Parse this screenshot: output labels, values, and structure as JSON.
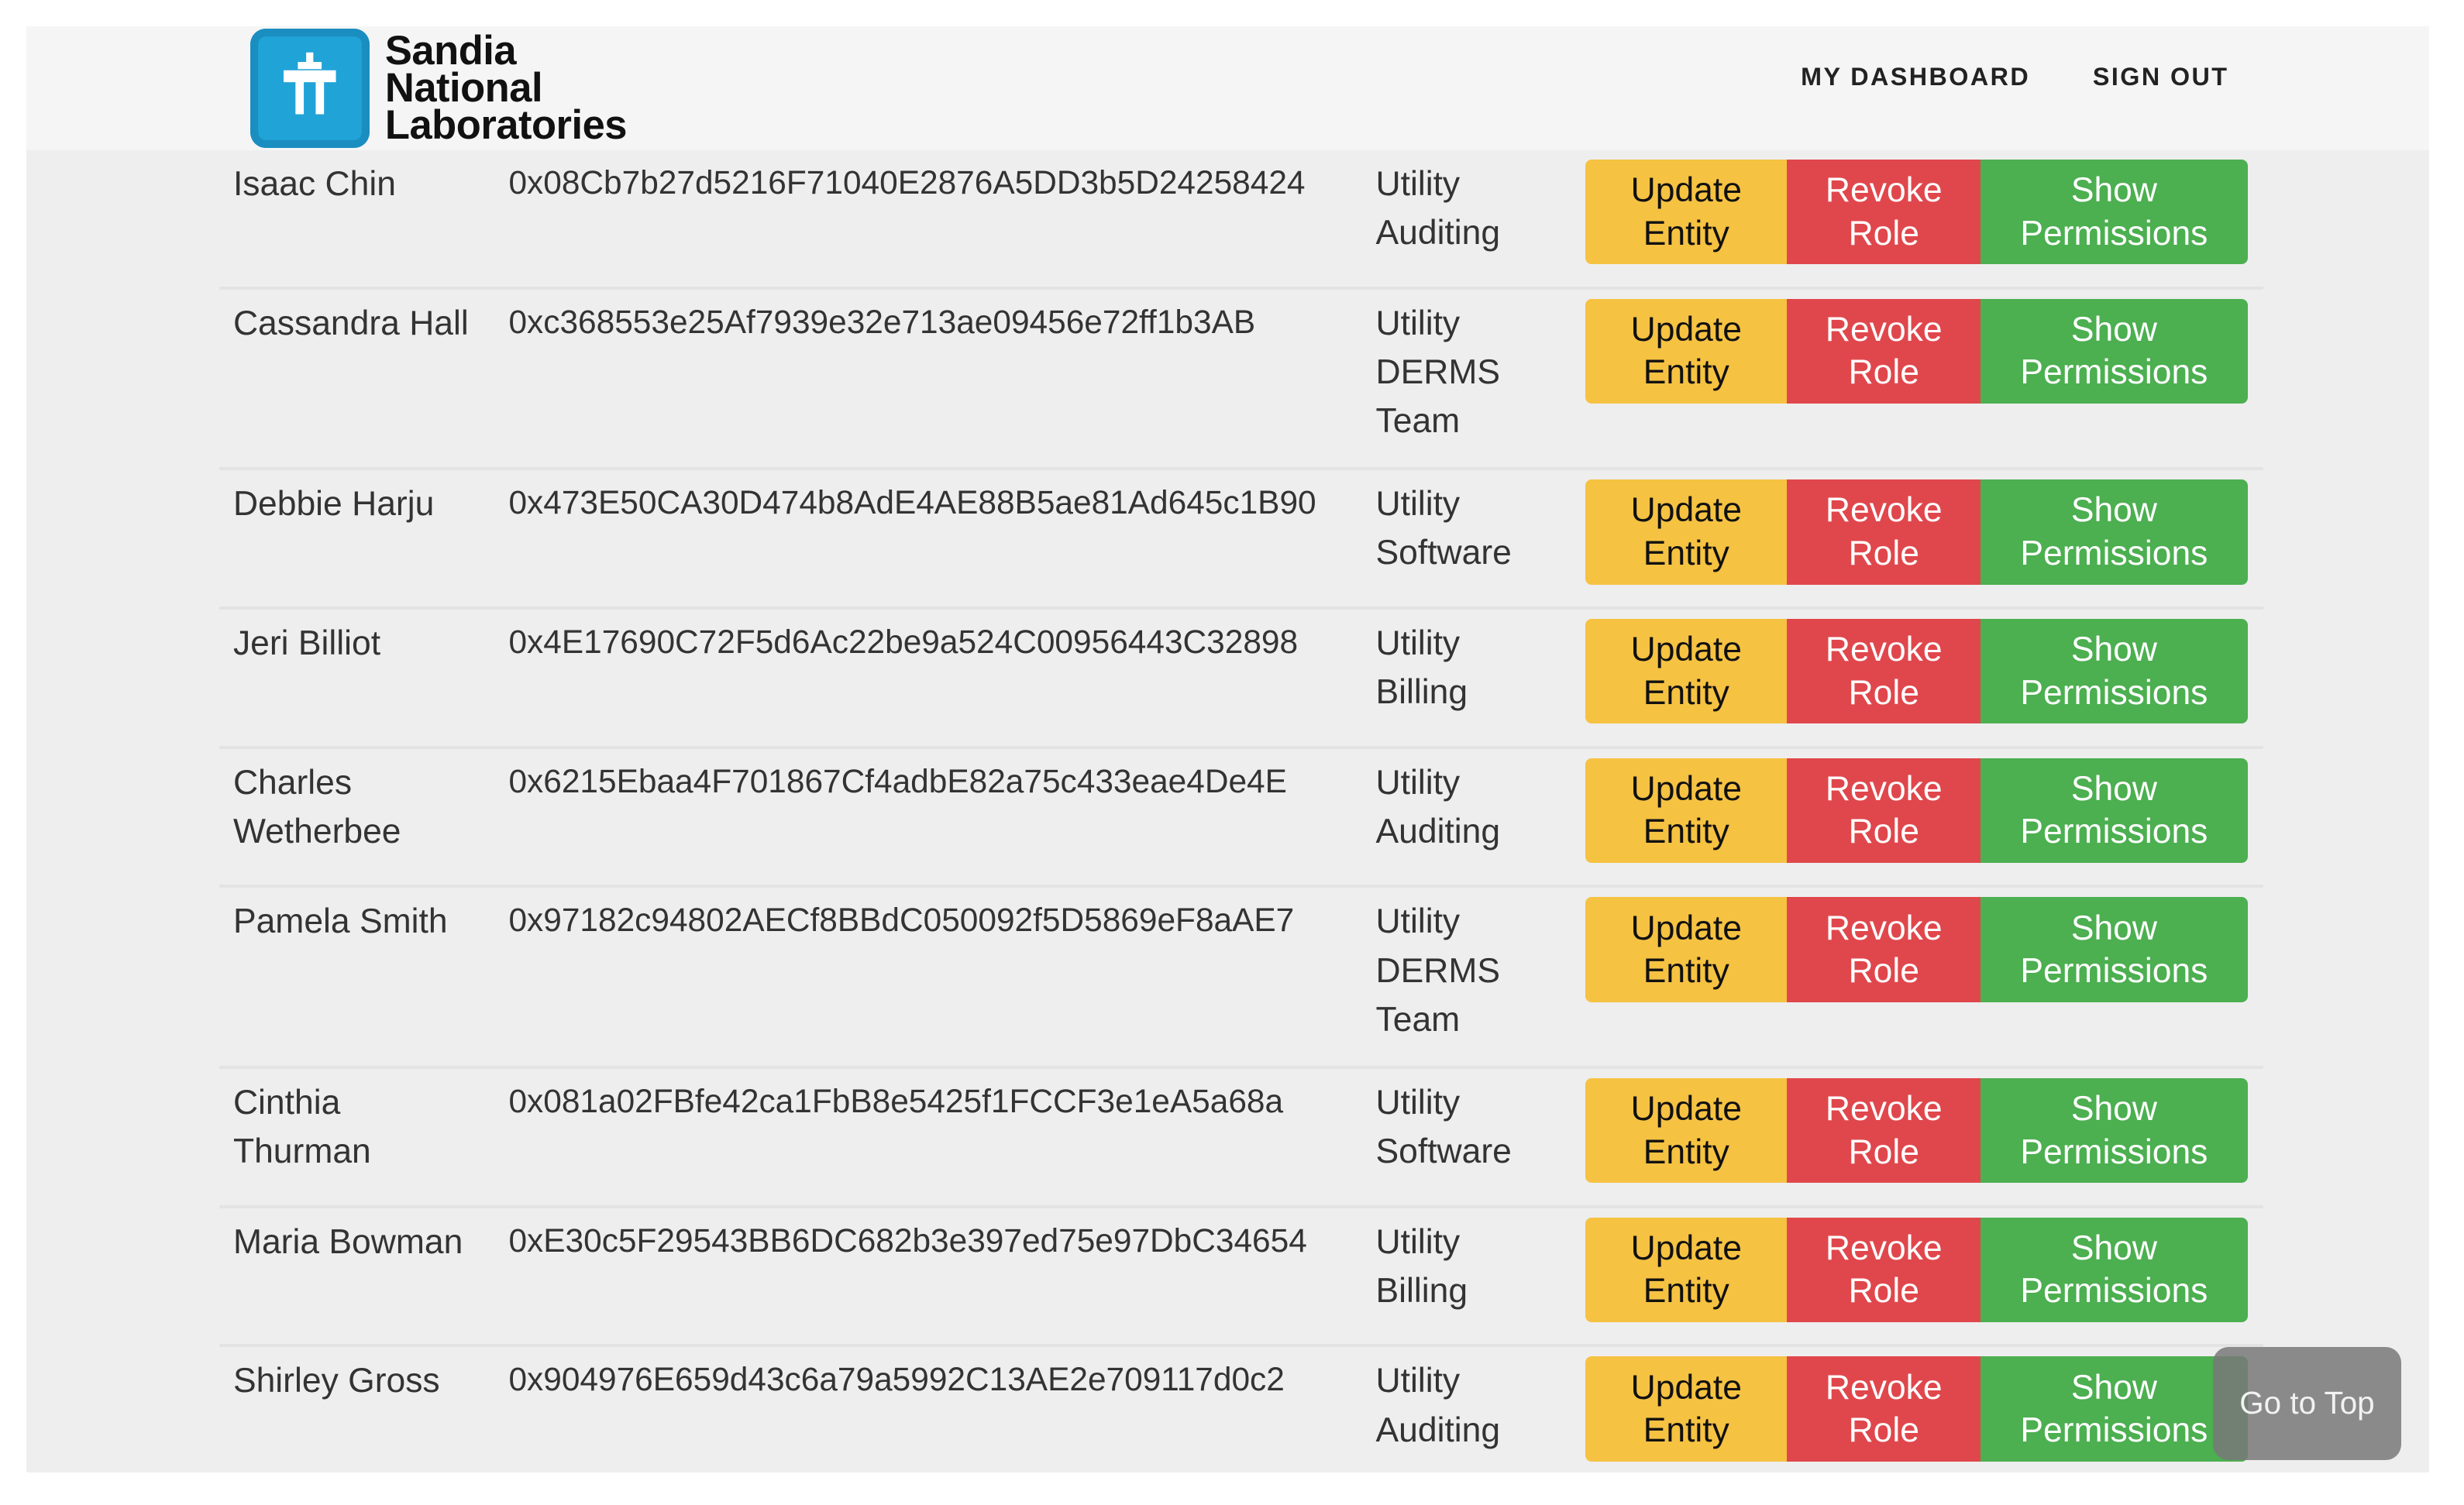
{
  "app": {
    "org_name_lines": [
      "Sandia",
      "National",
      "Laboratories"
    ]
  },
  "nav": {
    "dashboard_label": "MY DASHBOARD",
    "signout_label": "SIGN OUT"
  },
  "actions": {
    "update_label": "Update Entity",
    "revoke_label": "Revoke Role",
    "show_label": "Show Permissions"
  },
  "table": {
    "rows": [
      {
        "name": "Isaac Chin",
        "address": "0x08Cb7b27d5216F71040E2876A5DD3b5D24258424",
        "role_lines": [
          "Utility",
          "Auditing"
        ]
      },
      {
        "name": "Cassandra Hall",
        "address": "0xc368553e25Af7939e32e713ae09456e72ff1b3AB",
        "role_lines": [
          "Utility",
          "DERMS",
          "Team"
        ]
      },
      {
        "name": "Debbie Harju",
        "address": "0x473E50CA30D474b8AdE4AE88B5ae81Ad645c1B90",
        "role_lines": [
          "Utility",
          "Software"
        ]
      },
      {
        "name": "Jeri Billiot",
        "address": "0x4E17690C72F5d6Ac22be9a524C00956443C32898",
        "role_lines": [
          "Utility",
          "Billing"
        ]
      },
      {
        "name": "Charles Wetherbee",
        "address": "0x6215Ebaa4F701867Cf4adbE82a75c433eae4De4E",
        "role_lines": [
          "Utility",
          "Auditing"
        ]
      },
      {
        "name": "Pamela Smith",
        "address": "0x97182c94802AECf8BBdC050092f5D5869eF8aAE7",
        "role_lines": [
          "Utility",
          "DERMS",
          "Team"
        ]
      },
      {
        "name": "Cinthia Thurman",
        "address": "0x081a02FBfe42ca1FbB8e5425f1FCCF3e1eA5a68a",
        "role_lines": [
          "Utility",
          "Software"
        ]
      },
      {
        "name": "Maria Bowman",
        "address": "0xE30c5F29543BB6DC682b3e397ed75e97DbC34654",
        "role_lines": [
          "Utility",
          "Billing"
        ]
      },
      {
        "name": "Shirley Gross",
        "address": "0x904976E659d43c6a79a5992C13AE2e709117d0c2",
        "role_lines": [
          "Utility",
          "Auditing"
        ]
      }
    ]
  },
  "goto_top_label": "Go to Top",
  "colors": {
    "update": "#f6c242",
    "revoke": "#e0474c",
    "show": "#4caf50"
  },
  "icons": {
    "logo": "thunderbird-logo-icon"
  }
}
